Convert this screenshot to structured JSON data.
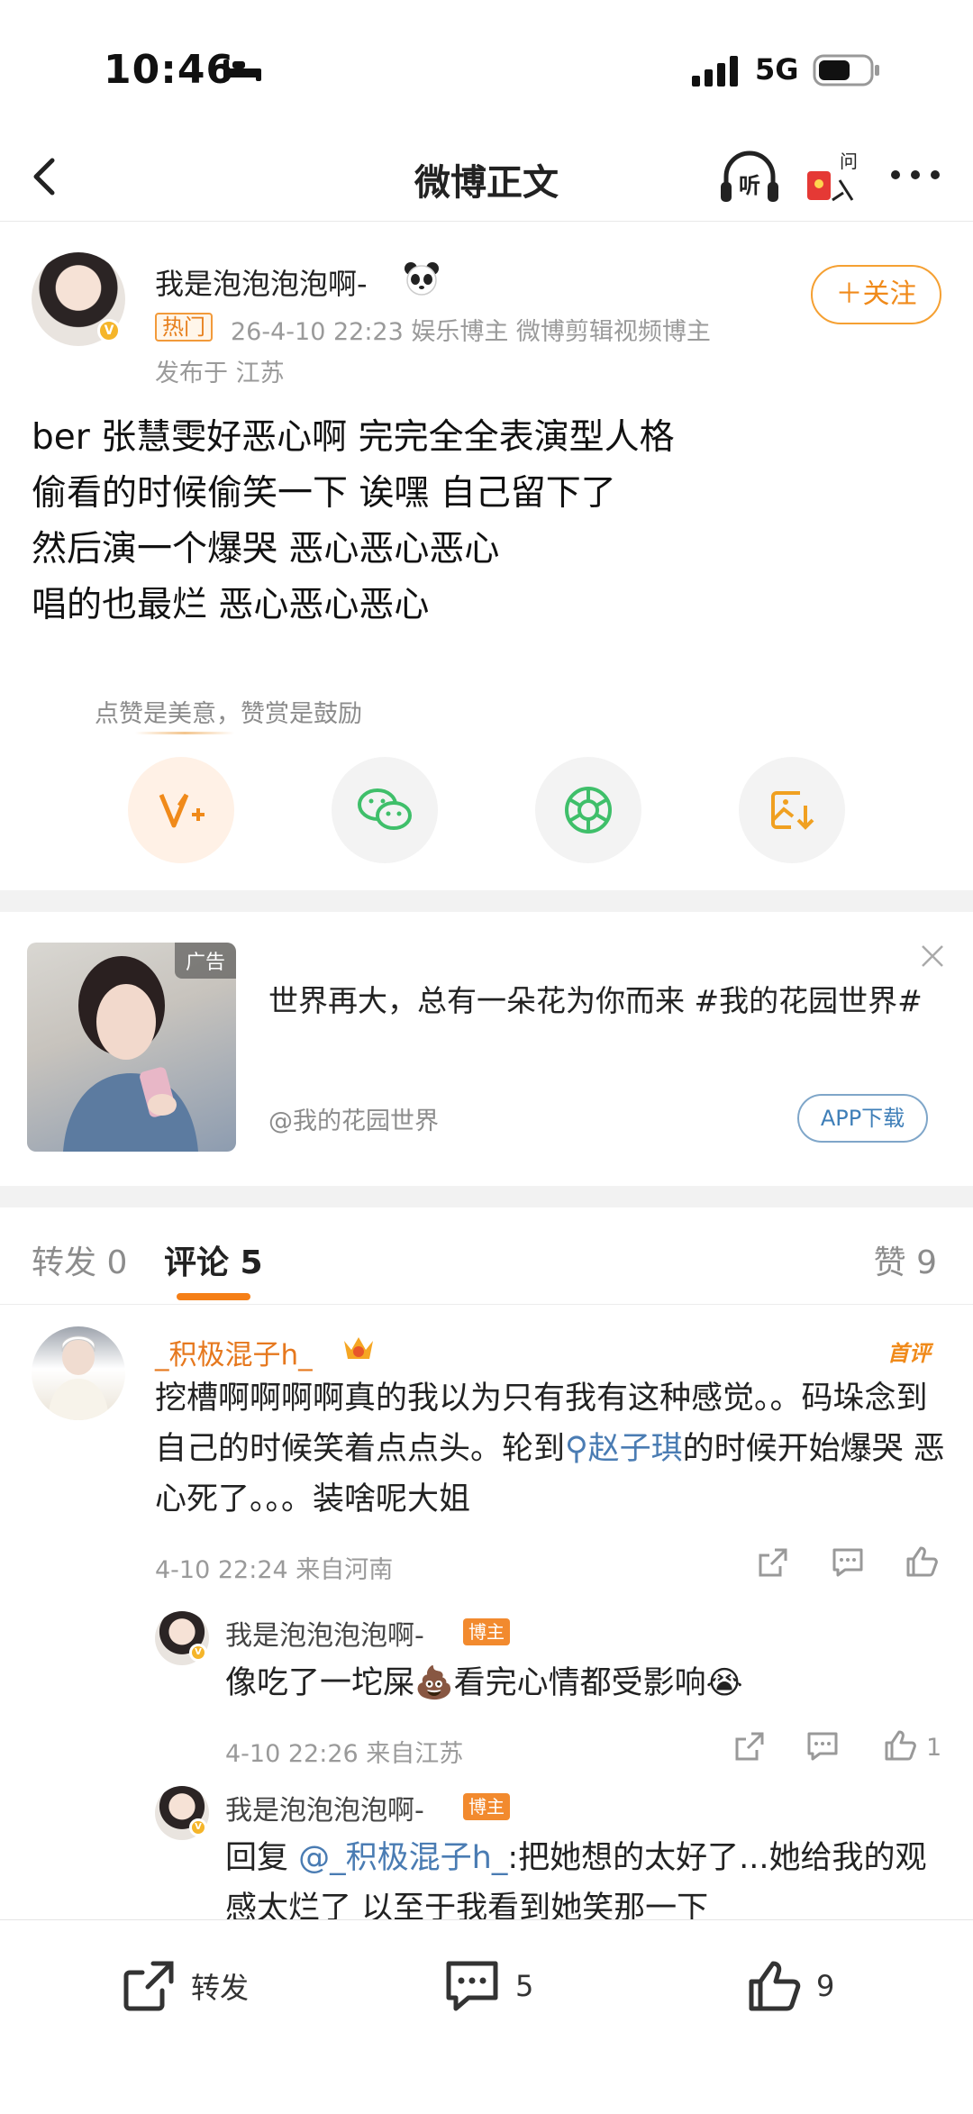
{
  "status_bar": {
    "time": "10:46",
    "network": "5G"
  },
  "nav": {
    "title": "微博正文",
    "icons": [
      "back-icon",
      "listen-icon",
      "ask-icon",
      "more-icon"
    ]
  },
  "post": {
    "author": "我是泡泡泡泡啊-",
    "hot_tag": "热门",
    "meta": "26-4-10 22:23  娱乐博主 微博剪辑视频博主",
    "location": "发布于 江苏",
    "follow_label": "＋关注",
    "lines": [
      "ber 张慧雯好恶心啊 完完全全表演型人格",
      "偷看的时候偷笑一下 诶嘿 自己留下了",
      "然后演一个爆哭 恶心恶心恶心",
      "唱的也最烂 恶心恶心恶心"
    ]
  },
  "reward": {
    "tip": "点赞是美意，赞赏是鼓励"
  },
  "ad": {
    "label": "广告",
    "text": "世界再大，总有一朵花为你而来 #我的花园世界#",
    "source": "@我的花园世界",
    "button": "APP下载"
  },
  "tabs": {
    "repost": "转发 0",
    "comment": "评论 5",
    "like": "赞 9"
  },
  "comments": [
    {
      "name": "_积极混子h_",
      "badge": "首评",
      "text_a": "挖槽啊啊啊啊真的我以为只有我有这种感觉。。码垛念到自己的时候笑着点点头。轮到",
      "mention": "赵子琪",
      "text_b": "的时候开始爆哭 恶心死了。。。装啥呢大姐",
      "meta": "4-10 22:24  来自河南"
    }
  ],
  "replies": [
    {
      "name": "我是泡泡泡泡啊-",
      "tag": "博主",
      "text": "像吃了一坨屎💩看完心情都受影响😭",
      "meta": "4-10 22:26  来自江苏",
      "likes": "1"
    },
    {
      "name": "我是泡泡泡泡啊-",
      "tag": "博主",
      "prefix": "回复 ",
      "mention": "@_积极混子h_",
      "text": ":把她想的太好了...她给我的观感太烂了 以至于我看到她笑那一下"
    }
  ],
  "bottom_bar": {
    "repost": "转发",
    "comment": "5",
    "like": "9"
  }
}
